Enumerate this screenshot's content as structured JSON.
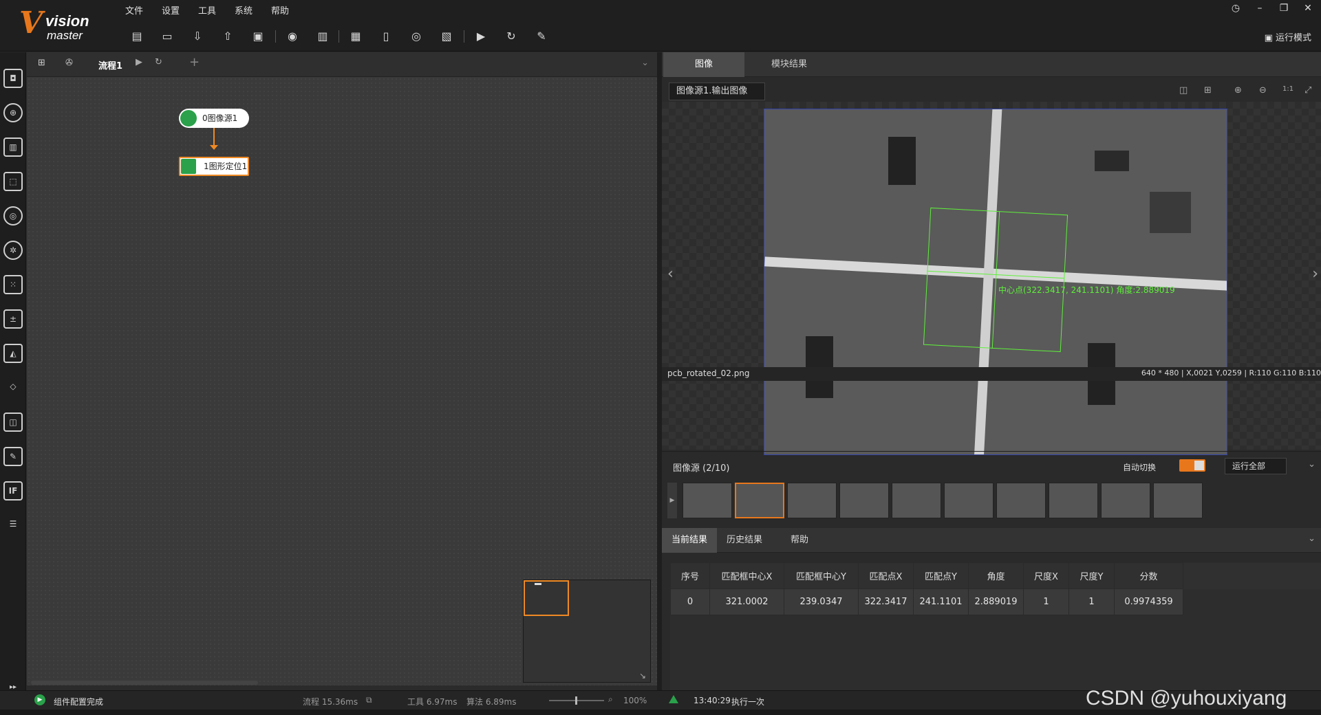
{
  "app": {
    "logo_main": "vision",
    "logo_sub": "master"
  },
  "menu": [
    "文件",
    "设置",
    "工具",
    "系统",
    "帮助"
  ],
  "toolbar_icons": [
    "save-icon",
    "open-folder-icon",
    "import-icon",
    "export-icon",
    "solution-icon",
    "camera-icon",
    "controller-icon",
    "variable-icon",
    "communication-icon",
    "global-trigger-icon",
    "script-icon",
    "run-once-icon",
    "run-loop-icon",
    "report-icon"
  ],
  "window": {
    "run_mode": "运行模式"
  },
  "flow": {
    "tab_label": "流程1",
    "add": "+"
  },
  "nodes": [
    {
      "label": "0图像源1"
    },
    {
      "label": "1图形定位1"
    }
  ],
  "right": {
    "tabs": [
      "图像",
      "模块结果"
    ],
    "image_selector": "图像源1.输出图像",
    "filename": "pcb_rotated_02.png",
    "pixel_info": "640 * 480 | X,0021 Y,0259 | R:110 G:110 B:110",
    "overlay_text": "中心点(322.3417, 241.1101) 角度:2.889019",
    "source_title": "图像源 (2/10)",
    "auto_switch": "自动切换",
    "run_all": "运行全部",
    "result_tabs": [
      "当前结果",
      "历史结果",
      "帮助"
    ],
    "table_headers": [
      "序号",
      "匹配框中心X",
      "匹配框中心Y",
      "匹配点X",
      "匹配点Y",
      "角度",
      "尺度X",
      "尺度Y",
      "分数"
    ],
    "table_rows": [
      [
        "0",
        "321.0002",
        "239.0347",
        "322.3417",
        "241.1101",
        "2.889019",
        "1",
        "1",
        "0.9974359"
      ]
    ]
  },
  "status": {
    "left": "组件配置完成",
    "flow_time": "流程 15.36ms",
    "tool_time": "工具 6.97ms",
    "algo_time": "算法 6.89ms",
    "zoom": "100%",
    "run_time": "13:40:29",
    "run_text": "执行一次",
    "watermark": "CSDN @yuhouxiyang"
  }
}
